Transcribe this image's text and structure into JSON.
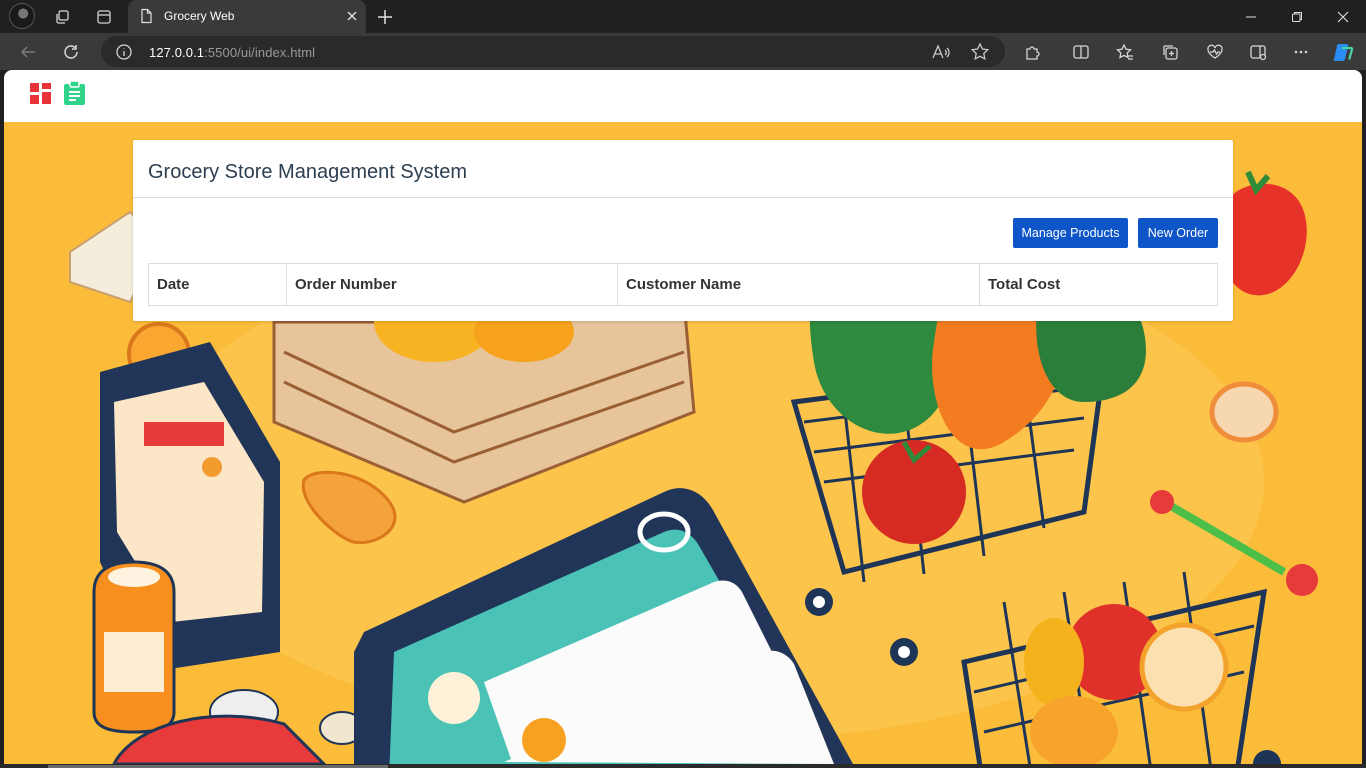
{
  "browser": {
    "tab_title": "Grocery Web",
    "url_host": "127.0.0.1",
    "url_rest": ":5500/ui/index.html"
  },
  "app": {
    "title": "Grocery Store Management System",
    "buttons": {
      "manage_products": "Manage Products",
      "new_order": "New Order"
    },
    "table": {
      "headers": [
        "Date",
        "Order Number",
        "Customer Name",
        "Total Cost"
      ],
      "rows": []
    }
  },
  "icons": {
    "nav_logo": "dashboard-grid-icon",
    "nav_orders": "clipboard-icon"
  },
  "colors": {
    "primary_button": "#0d55c9",
    "background": "#fbbc3a",
    "logo_red": "#e8333a",
    "logo_green": "#2fd48a"
  }
}
